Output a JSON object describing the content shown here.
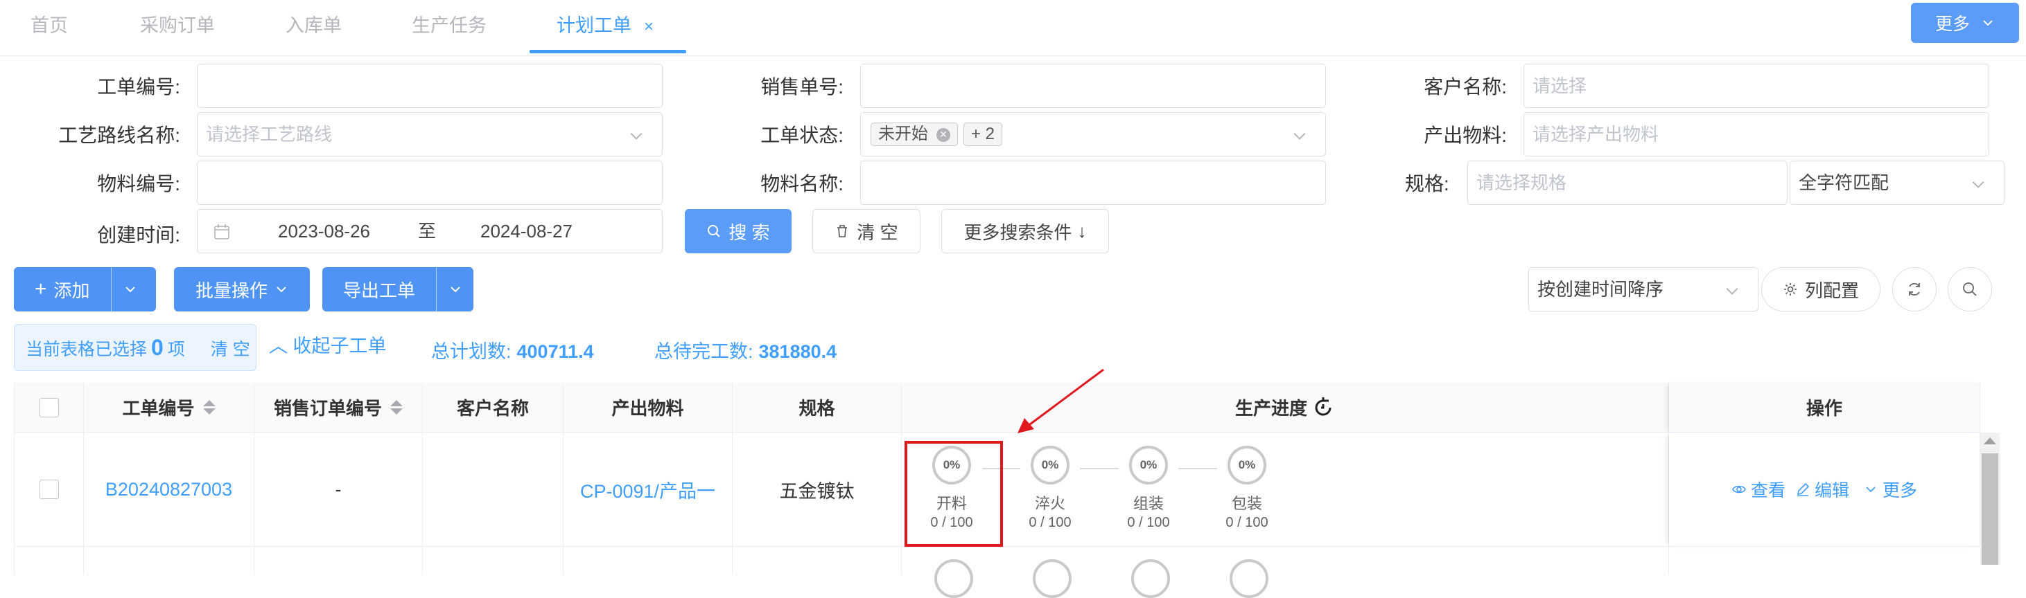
{
  "tabs": [
    {
      "label": "首页",
      "active": false
    },
    {
      "label": "采购订单",
      "active": false
    },
    {
      "label": "入库单",
      "active": false
    },
    {
      "label": "生产任务",
      "active": false
    },
    {
      "label": "计划工单",
      "active": true
    }
  ],
  "tab_close": "×",
  "more_button": "更多",
  "search": {
    "work_order_no_label": "工单编号:",
    "sales_no_label": "销售单号:",
    "customer_label": "客户名称:",
    "customer_placeholder": "请选择",
    "route_label": "工艺路线名称:",
    "route_placeholder": "请选择工艺路线",
    "status_label": "工单状态:",
    "status_tag": "未开始",
    "status_more": "+ 2",
    "output_material_label": "产出物料:",
    "output_material_placeholder": "请选择产出物料",
    "material_no_label": "物料编号:",
    "material_name_label": "物料名称:",
    "spec_label": "规格",
    "spec_label_colon": ":",
    "spec_placeholder": "请选择规格",
    "match_mode": "全字符匹配",
    "created_label": "创建时间:",
    "date_start": "2023-08-26",
    "date_to": "至",
    "date_end": "2024-08-27",
    "search_button": "搜 索",
    "clear_button": "清 空",
    "more_conditions": "更多搜索条件"
  },
  "toolbar": {
    "add": "添加",
    "batch": "批量操作",
    "export": "导出工单",
    "sort": "按创建时间降序",
    "columns": "列配置"
  },
  "info": {
    "selected_prefix": "当前表格已选择",
    "selected_count": "0",
    "selected_suffix": "项",
    "clear": "清 空",
    "collapse": "收起子工单",
    "total_plan_label": "总计划数:",
    "total_plan_value": "400711.4",
    "total_pending_label": "总待完工数:",
    "total_pending_value": "381880.4"
  },
  "table": {
    "headers": {
      "work_order_no": "工单编号",
      "sales_order_no": "销售订单编号",
      "customer": "客户名称",
      "output_material": "产出物料",
      "spec": "规格",
      "progress": "生产进度",
      "actions": "操作"
    },
    "rows": [
      {
        "work_order_no": "B20240827003",
        "sales_order_no": "-",
        "customer": "",
        "output_material": "CP-0091/产品一",
        "spec": "五金镀钛",
        "steps": [
          {
            "pct": "0%",
            "name": "开料",
            "qty": "0 / 100"
          },
          {
            "pct": "0%",
            "name": "淬火",
            "qty": "0 / 100"
          },
          {
            "pct": "0%",
            "name": "组装",
            "qty": "0 / 100"
          },
          {
            "pct": "0%",
            "name": "包装",
            "qty": "0 / 100"
          }
        ],
        "actions": {
          "view": "查看",
          "edit": "编辑",
          "more": "更多"
        }
      }
    ]
  },
  "colors": {
    "primary": "#409eff",
    "button": "#5a9cf8",
    "highlight": "#e0181e"
  }
}
